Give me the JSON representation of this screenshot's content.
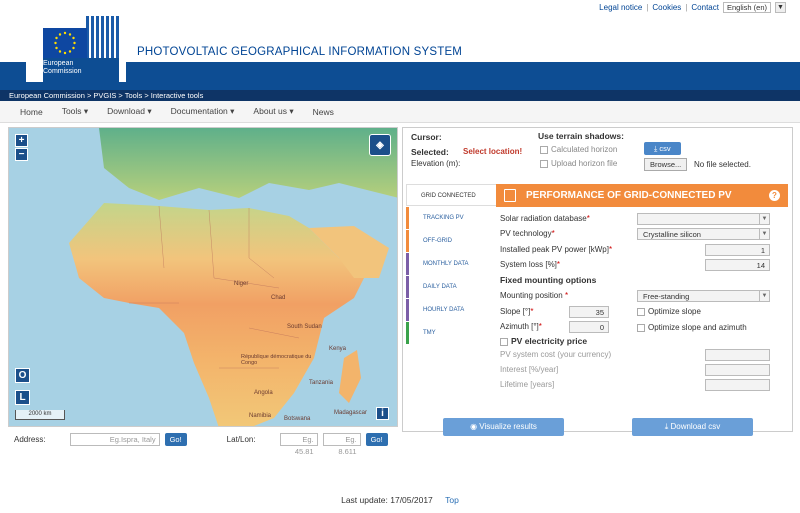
{
  "toplinks": {
    "legal": "Legal notice",
    "cookies": "Cookies",
    "contact": "Contact",
    "language": "English (en)"
  },
  "logo": {
    "line1": "European",
    "line2": "Commission"
  },
  "app_title": "PHOTOVOLTAIC GEOGRAPHICAL INFORMATION SYSTEM",
  "breadcrumb": "European Commission > PVGIS > Tools > Interactive tools",
  "nav": [
    {
      "label": "Home"
    },
    {
      "label": "Tools ▾"
    },
    {
      "label": "Download ▾"
    },
    {
      "label": "Documentation ▾"
    },
    {
      "label": "About us ▾"
    },
    {
      "label": "News"
    }
  ],
  "map": {
    "scale": "2000 km",
    "zoom_in": "+",
    "zoom_out": "−",
    "btn_o": "O",
    "btn_l": "L",
    "info": "i"
  },
  "map_labels": [
    "Niger",
    "Chad",
    "South Sudan",
    "Kenya",
    "République démocratique du Congo",
    "Tanzania",
    "Angola",
    "Namibia",
    "Botswana",
    "Madagascar"
  ],
  "address": {
    "label": "Address:",
    "placeholder": "Eg.Ispra, Italy",
    "go": "Go!"
  },
  "latlon": {
    "label": "Lat/Lon:",
    "lat_placeholder": "Eg. 45.81",
    "lon_placeholder": "Eg. 8.611",
    "go": "Go!"
  },
  "cursor": {
    "cursor_label": "Cursor:",
    "selected_label": "Selected:",
    "selected_value": "Select location!",
    "elevation_label": "Elevation (m):"
  },
  "shadows": {
    "title": "Use terrain shadows:",
    "calculated": "Calculated horizon",
    "upload": "Upload horizon file",
    "csv": "csv",
    "browse": "Browse...",
    "no_file": "No file selected."
  },
  "tabs": [
    {
      "label": "GRID CONNECTED",
      "color": "#333333"
    },
    {
      "label": "TRACKING PV",
      "color": "#f28b3c"
    },
    {
      "label": "OFF-GRID",
      "color": "#f28b3c"
    },
    {
      "label": "MONTHLY DATA",
      "color": "#7b5ea7"
    },
    {
      "label": "DAILY DATA",
      "color": "#7b5ea7"
    },
    {
      "label": "HOURLY DATA",
      "color": "#7b5ea7"
    },
    {
      "label": "TMY",
      "color": "#3aa24b"
    }
  ],
  "perf": {
    "title": "PERFORMANCE OF GRID-CONNECTED PV",
    "help": "?",
    "db_label": "Solar radiation database",
    "db_value": "",
    "tech_label": "PV technology",
    "tech_value": "Crystalline silicon",
    "peak_label": "Installed peak PV power [kWp]",
    "peak_value": "1",
    "loss_label": "System loss [%]",
    "loss_value": "14",
    "fixed_title": "Fixed mounting options",
    "mount_label": "Mounting position",
    "mount_value": "Free-standing",
    "slope_label": "Slope [°]",
    "slope_value": "35",
    "azimuth_label": "Azimuth [°]",
    "azimuth_value": "0",
    "opt_slope": "Optimize slope",
    "opt_slope_az": "Optimize slope and azimuth",
    "price_title": "PV electricity price",
    "cost_label": "PV system cost (your currency)",
    "interest_label": "Interest [%/year]",
    "lifetime_label": "Lifetime [years]"
  },
  "buttons": {
    "visualize": "Visualize results",
    "download": "Download csv"
  },
  "footer": {
    "last_update": "Last update: 17/05/2017",
    "top": "Top"
  }
}
